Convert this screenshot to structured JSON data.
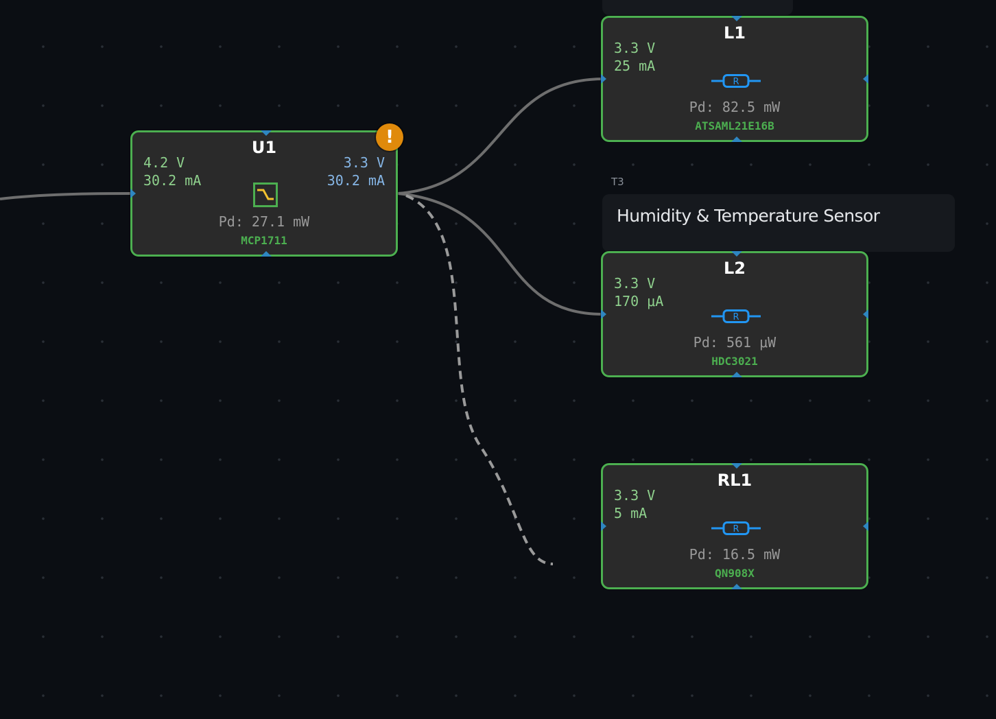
{
  "group": {
    "tag": "T3",
    "title": "Humidity & Temperature Sensor"
  },
  "nodes": {
    "u1": {
      "name": "U1",
      "vin": "4.2 V",
      "iin": "30.2 mA",
      "vout": "3.3 V",
      "iout": "30.2 mA",
      "pd": "Pd: 27.1 mW",
      "part": "MCP1711",
      "icon": "regulator-icon",
      "warning": "!"
    },
    "l1": {
      "name": "L1",
      "vin": "3.3 V",
      "iin": "25 mA",
      "pd": "Pd: 82.5 mW",
      "part": "ATSAML21E16B",
      "icon": "resistor-icon",
      "icon_label": "R"
    },
    "l2": {
      "name": "L2",
      "vin": "3.3 V",
      "iin": "170 μA",
      "pd": "Pd: 561 μW",
      "part": "HDC3021",
      "icon": "resistor-icon",
      "icon_label": "R"
    },
    "rl1": {
      "name": "RL1",
      "vin": "3.3 V",
      "iin": "5 mA",
      "pd": "Pd: 16.5 mW",
      "part": "QN908X",
      "icon": "resistor-icon",
      "icon_label": "R"
    }
  },
  "colors": {
    "background": "#0b0e13",
    "node_border_ok": "#4caf50",
    "input_text": "#8fd18d",
    "output_text": "#86b6e6",
    "port": "#2e86c1",
    "warning": "#e08a0b",
    "wire": "#6e6e6e"
  }
}
